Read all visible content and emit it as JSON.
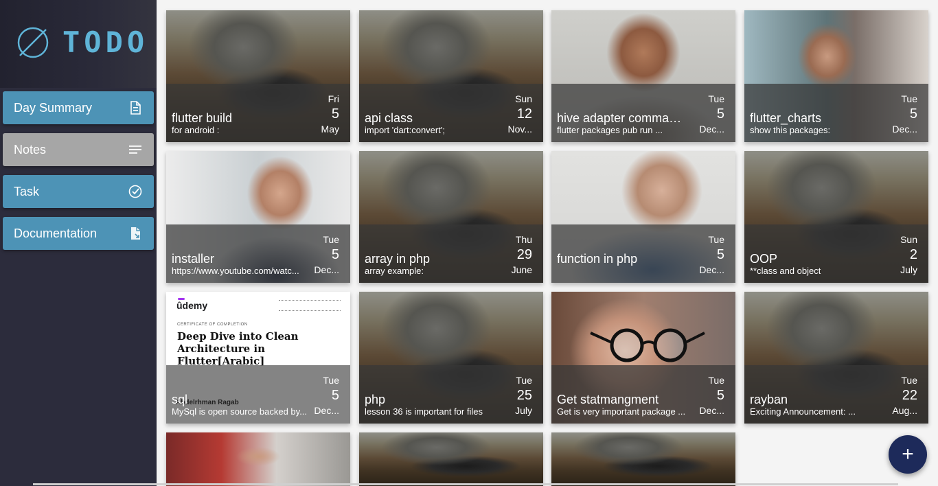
{
  "app": {
    "logo_text": "TODO"
  },
  "sidebar": {
    "items": [
      {
        "label": "Day Summary",
        "icon": "document-icon"
      },
      {
        "label": "Notes",
        "icon": "notes-lines-icon"
      },
      {
        "label": "Task",
        "icon": "check-circle-icon"
      },
      {
        "label": "Documentation",
        "icon": "document-arrow-icon"
      }
    ]
  },
  "notes": [
    {
      "title": "flutter build",
      "subtitle": "for android :",
      "day": "Fri",
      "num": "5",
      "month": "May"
    },
    {
      "title": "api class",
      "subtitle": "import 'dart:convert';",
      "day": "Sun",
      "num": "12",
      "month": "Nov..."
    },
    {
      "title": "hive adapter command ...",
      "subtitle": "flutter packages pub run ...",
      "day": "Tue",
      "num": "5",
      "month": "Dec..."
    },
    {
      "title": "flutter_charts",
      "subtitle": "show this packages:",
      "day": "Tue",
      "num": "5",
      "month": "Dec..."
    },
    {
      "title": "installer",
      "subtitle": "https://www.youtube.com/watc...",
      "day": "Tue",
      "num": "5",
      "month": "Dec..."
    },
    {
      "title": "array in php",
      "subtitle": "array example:",
      "day": "Thu",
      "num": "29",
      "month": "June"
    },
    {
      "title": "function in php",
      "subtitle": "",
      "day": "Tue",
      "num": "5",
      "month": "Dec..."
    },
    {
      "title": "OOP",
      "subtitle": "**class and object",
      "day": "Sun",
      "num": "2",
      "month": "July"
    },
    {
      "title": "sql",
      "subtitle": "MySql is open source backed by...",
      "day": "Tue",
      "num": "5",
      "month": "Dec..."
    },
    {
      "title": "php",
      "subtitle": "lesson 36 is important for files",
      "day": "Tue",
      "num": "25",
      "month": "July"
    },
    {
      "title": "Get statmangment",
      "subtitle": "Get  is very important package ...",
      "day": "Tue",
      "num": "5",
      "month": "Dec..."
    },
    {
      "title": "rayban",
      "subtitle": "Exciting Announcement: ...",
      "day": "Tue",
      "num": "22",
      "month": "Aug..."
    }
  ],
  "certificate": {
    "brand": "ûdemy",
    "small": "CERTIFICATE OF COMPLETION",
    "title": "Deep Dive into Clean Architecture in Flutter[Arabic]",
    "name": "Abdelrhman Ragab"
  },
  "fab": {
    "label": "+"
  },
  "colors": {
    "sidebar": "#2c2c3c",
    "nav_blue": "#4d93b6",
    "nav_gray": "#a6a6a6",
    "logo": "#5fb4d8",
    "fab": "#1d2a5a"
  }
}
